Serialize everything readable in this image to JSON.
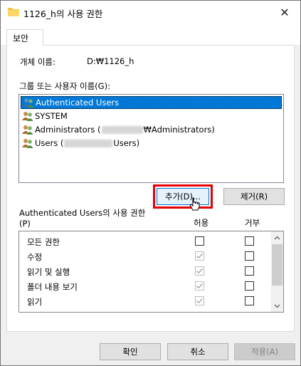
{
  "window": {
    "title": "1126_h의 사용 권한",
    "close_symbol": "✕"
  },
  "tabs": [
    {
      "label": "보안"
    }
  ],
  "object_name": {
    "label": "개체 이름:",
    "value": "D:₩1126_h"
  },
  "groups": {
    "label": "그룹 또는 사용자 이름(G):",
    "items": [
      {
        "label": "Authenticated Users",
        "selected": true
      },
      {
        "label": "SYSTEM",
        "selected": false
      },
      {
        "prefix": "Administrators (",
        "suffix": "₩Administrators)",
        "selected": false
      },
      {
        "prefix": "Users (",
        "suffix": "Users)",
        "selected": false
      }
    ]
  },
  "buttons": {
    "add": "추가(D)...",
    "remove": "제거(R)",
    "ok": "확인",
    "cancel": "취소",
    "apply": "적용(A)"
  },
  "permissions": {
    "label_line1": "Authenticated Users의 사용 권한",
    "label_line2": "(P)",
    "allow_header": "허용",
    "deny_header": "거부",
    "rows": [
      {
        "name": "모든 권한",
        "allow": false,
        "allow_inherited": false,
        "deny": false
      },
      {
        "name": "수정",
        "allow": true,
        "allow_inherited": true,
        "deny": false
      },
      {
        "name": "읽기 및 실행",
        "allow": true,
        "allow_inherited": true,
        "deny": false
      },
      {
        "name": "폴더 내용 보기",
        "allow": true,
        "allow_inherited": true,
        "deny": false
      },
      {
        "name": "읽기",
        "allow": true,
        "allow_inherited": true,
        "deny": false
      }
    ]
  },
  "colors": {
    "selection": "#0078d7",
    "highlight_box": "#e60000"
  }
}
